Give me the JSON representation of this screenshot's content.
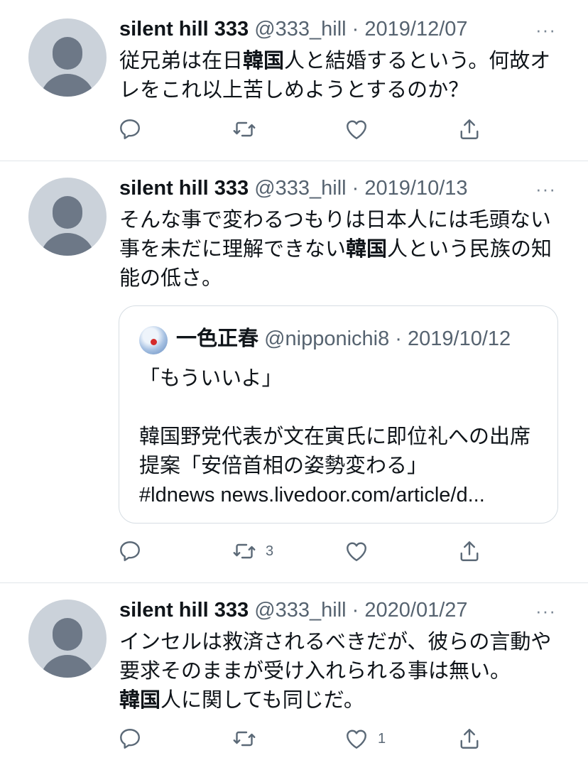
{
  "tweets": [
    {
      "name": "silent hill 333",
      "meta": "@333_hill · 2019/12/07",
      "more": "···",
      "text": [
        {
          "t": "従兄弟は在日"
        },
        {
          "t": "韓国",
          "hl": true
        },
        {
          "t": "人と結婚するという。何故オレをこれ以上苦しめようとするのか？"
        }
      ],
      "retweet_count": "",
      "like_count": ""
    },
    {
      "name": "silent hill 333",
      "meta": "@333_hill · 2019/10/13",
      "more": "···",
      "text": [
        {
          "t": "そんな事で変わるつもりは日本人には毛頭ない事を未だに理解できない"
        },
        {
          "t": "韓国",
          "hl": true
        },
        {
          "t": "人という民族の知能の低さ。"
        }
      ],
      "quote": {
        "name": "一色正春",
        "meta": "@nipponichi8 · 2019/10/12",
        "text": "「もういいよ」\n\n韓国野党代表が文在寅氏に即位礼への出席提案「安倍首相の姿勢変わる」\n#ldnews news.livedoor.com/article/d..."
      },
      "retweet_count": "3",
      "like_count": ""
    },
    {
      "name": "silent hill 333",
      "meta": "@333_hill · 2020/01/27",
      "more": "···",
      "text": [
        {
          "t": "インセルは救済されるべきだが、彼らの言動や要求そのままが受け入れられる事は無い。\n"
        },
        {
          "t": "韓国",
          "hl": true
        },
        {
          "t": "人に関しても同じだ。"
        }
      ],
      "retweet_count": "",
      "like_count": "1"
    }
  ],
  "icons": [
    "reply-icon",
    "retweet-icon",
    "like-icon",
    "share-icon",
    "more-icon"
  ],
  "colors": {
    "text": "#0f1419",
    "secondary": "#566370",
    "avatar_bg": "#cbd2da",
    "avatar_fg": "#6d7887",
    "divider": "#e1e6ea"
  }
}
